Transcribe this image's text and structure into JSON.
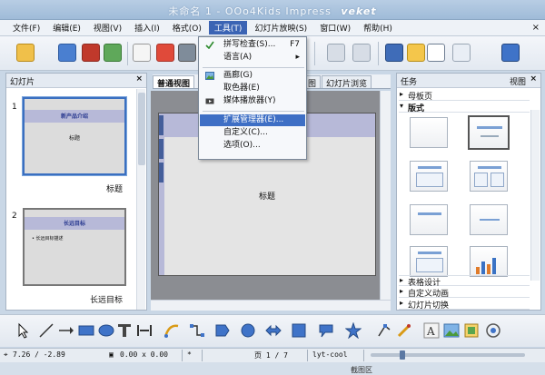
{
  "window": {
    "title": "未命名 1 - OOo4Kids Impress",
    "brand": "veket"
  },
  "menu": {
    "items": [
      "文件(F)",
      "编辑(E)",
      "视图(V)",
      "插入(I)",
      "格式(O)",
      "工具(T)",
      "幻灯片放映(S)",
      "窗口(W)",
      "帮助(H)"
    ],
    "active_index": 5,
    "close": "×"
  },
  "tools_menu": {
    "items": [
      {
        "label": "拼写检查(S)...",
        "shortcut": "F7",
        "icon": "spellcheck-icon"
      },
      {
        "label": "语言(A)",
        "shortcut": "▸",
        "icon": ""
      },
      {
        "label": "画廊(G)",
        "shortcut": "",
        "icon": "gallery-icon"
      },
      {
        "label": "取色器(E)",
        "shortcut": "",
        "icon": ""
      },
      {
        "label": "媒体播放器(Y)",
        "shortcut": "",
        "icon": "media-player-icon"
      },
      {
        "label": "扩展管理器(E)...",
        "shortcut": "",
        "icon": ""
      },
      {
        "label": "自定义(C)...",
        "shortcut": "",
        "icon": ""
      },
      {
        "label": "选项(O)...",
        "shortcut": "",
        "icon": ""
      }
    ],
    "highlighted_index": 5
  },
  "slides_pane": {
    "title": "幻灯片",
    "close": "×",
    "slides": [
      {
        "number": "1",
        "heading": "新产品介绍",
        "body": "标题",
        "caption": "标题"
      },
      {
        "number": "2",
        "heading": "长远目标",
        "body": "• 长远目标描述",
        "caption": "长远目标"
      }
    ]
  },
  "view_tabs": {
    "items": [
      "普通视图",
      "图",
      "幻灯片浏览"
    ],
    "active_index": 0
  },
  "editor": {
    "slide_text": "标题"
  },
  "task_pane": {
    "title": "任务",
    "view_label": "视图",
    "close": "×",
    "sections": {
      "master": "母板页",
      "layouts": "版式",
      "table_design": "表格设计",
      "custom_animation": "自定义动画",
      "slide_transition": "幻灯片切换"
    }
  },
  "statusbar": {
    "position": "7.26 / -2.89",
    "size": "0.00 x 0.00",
    "modified": "*",
    "page": "页 1 / 7",
    "master": "lyt-cool"
  },
  "bottom_text": "截图区"
}
